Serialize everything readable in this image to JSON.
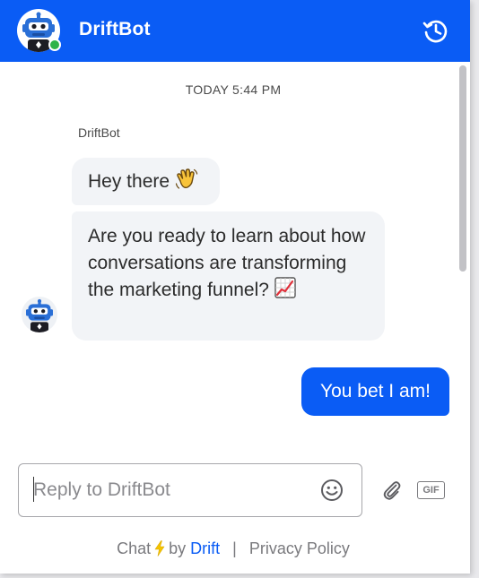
{
  "header": {
    "bot_name": "DriftBot",
    "status": "online",
    "history_icon": "history-clock-icon"
  },
  "conversation": {
    "timestamp": "TODAY 5:44 PM",
    "sender_name": "DriftBot",
    "bot_messages": [
      {
        "text": "Hey there",
        "emoji": "waving-hand"
      },
      {
        "text": "Are you ready to learn about how conversations are transforming the marketing funnel?",
        "emoji": "chart-increasing"
      }
    ],
    "user_message": "You bet I am!"
  },
  "composer": {
    "placeholder": "Reply to DriftBot",
    "value": ""
  },
  "footer": {
    "chat_text": "Chat",
    "by_text": "by",
    "drift_link": "Drift",
    "separator": "|",
    "privacy_link": "Privacy Policy"
  },
  "colors": {
    "brand_blue": "#0a5cf5",
    "bubble_bg": "#f2f4f7",
    "online_green": "#2fb34a",
    "bolt_yellow": "#f5c400"
  }
}
